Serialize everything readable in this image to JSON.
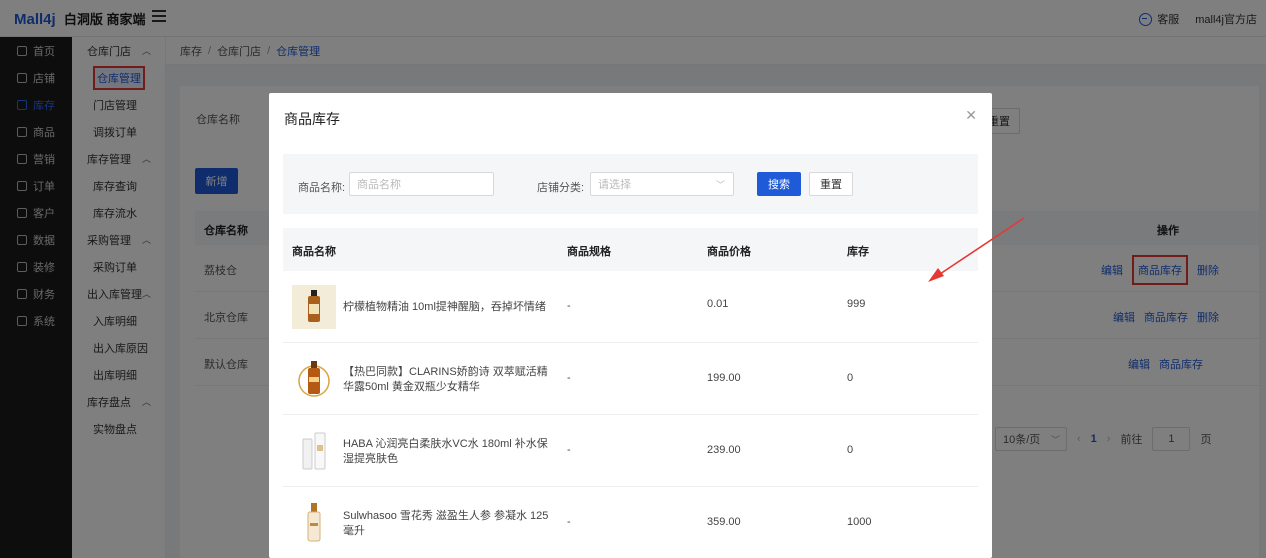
{
  "topbar": {
    "brand_logo": "Mall4j",
    "brand_suffix": "白洞版 商家端",
    "service_label": "客服",
    "shop_name": "mall4j官方店"
  },
  "sidebar": {
    "items": [
      {
        "label": "首页",
        "icon": "home-icon"
      },
      {
        "label": "店铺",
        "icon": "store-icon"
      },
      {
        "label": "库存",
        "icon": "inventory-icon",
        "active": true
      },
      {
        "label": "商品",
        "icon": "goods-icon"
      },
      {
        "label": "营销",
        "icon": "marketing-icon"
      },
      {
        "label": "订单",
        "icon": "order-icon"
      },
      {
        "label": "客户",
        "icon": "customer-icon"
      },
      {
        "label": "数据",
        "icon": "data-icon"
      },
      {
        "label": "装修",
        "icon": "decorate-icon"
      },
      {
        "label": "财务",
        "icon": "finance-icon"
      },
      {
        "label": "系统",
        "icon": "system-icon"
      }
    ]
  },
  "submenu": {
    "group1": "仓库门店",
    "warehouse_mgmt": "仓库管理",
    "store_mgmt": "门店管理",
    "transfer_order": "调拨订单",
    "group2": "库存管理",
    "stock_query": "库存查询",
    "stock_flow": "库存流水",
    "group3": "采购管理",
    "purchase_order": "采购订单",
    "group4": "出入库管理",
    "inbound_detail": "入库明细",
    "inout_reason": "出入库原因",
    "outbound_detail": "出库明细",
    "group5": "库存盘点",
    "physical_count": "实物盘点"
  },
  "breadcrumb": [
    "库存",
    "仓库门店",
    "仓库管理"
  ],
  "background": {
    "search_label": "仓库名称",
    "reset_label": "重置",
    "add_label": "新增",
    "col_name": "仓库名称",
    "col_ops": "操作",
    "rows": [
      {
        "name": "荔枝仓",
        "ops": [
          "编辑",
          "商品库存",
          "删除"
        ]
      },
      {
        "name": "北京仓库",
        "ops": [
          "编辑",
          "商品库存",
          "删除"
        ]
      },
      {
        "name": "默认仓库",
        "ops": [
          "编辑",
          "商品库存"
        ]
      }
    ],
    "pager": {
      "size": "10条/页",
      "page": "1",
      "goto_label": "前往",
      "goto_value": "1",
      "page_suffix": "页"
    }
  },
  "modal": {
    "title": "商品库存",
    "filter": {
      "name_label": "商品名称:",
      "name_placeholder": "商品名称",
      "category_label": "店铺分类:",
      "category_placeholder": "请选择",
      "search_button": "搜索",
      "reset_button": "重置"
    },
    "columns": {
      "name": "商品名称",
      "spec": "商品规格",
      "price": "商品价格",
      "stock": "库存"
    },
    "rows": [
      {
        "name": "柠檬植物精油 10ml提神醒脑，吞掉坏情绪",
        "spec": "-",
        "price": "0.01",
        "stock": "999"
      },
      {
        "name": "【热巴同款】CLARINS娇韵诗 双萃赋活精华露50ml 黄金双瓶少女精华",
        "spec": "-",
        "price": "199.00",
        "stock": "0"
      },
      {
        "name": "HABA 沁润亮白柔肤水VC水 180ml 补水保湿提亮肤色",
        "spec": "-",
        "price": "239.00",
        "stock": "0"
      },
      {
        "name": "Sulwhasoo 雪花秀 滋盈生人参 参凝水 125毫升",
        "spec": "-",
        "price": "359.00",
        "stock": "1000"
      }
    ]
  },
  "colors": {
    "accent": "#1f5bd9",
    "annotation": "#e53935",
    "sidebar_bg": "#1a1a1a"
  }
}
